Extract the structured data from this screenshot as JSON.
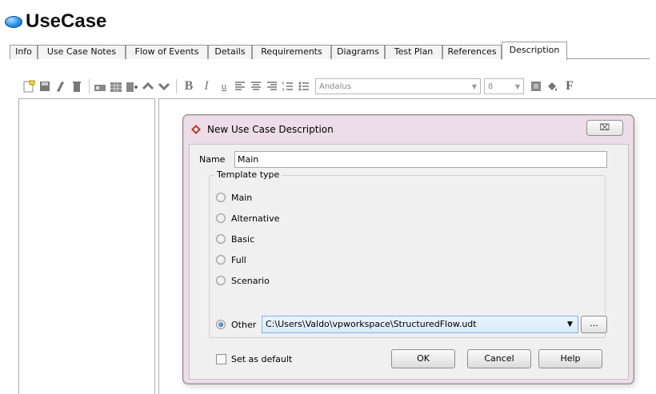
{
  "page": {
    "title": "UseCase"
  },
  "tabs": [
    {
      "label": "Info"
    },
    {
      "label": "Use Case Notes"
    },
    {
      "label": "Flow of Events"
    },
    {
      "label": "Details"
    },
    {
      "label": "Requirements"
    },
    {
      "label": "Diagrams"
    },
    {
      "label": "Test Plan"
    },
    {
      "label": "References"
    },
    {
      "label": "Description",
      "active": true
    }
  ],
  "toolbar": {
    "icons": [
      "new-page-icon",
      "save-icon",
      "format-icon",
      "delete-icon",
      "merge-cells-icon",
      "table-icon",
      "insert-row-icon",
      "move-up-icon",
      "move-down-icon"
    ],
    "bold": "B",
    "italic": "I",
    "underline": "u",
    "font_name": "Andalus",
    "font_size": "8",
    "trailing_text": "F"
  },
  "dialog": {
    "title": "New Use Case Description",
    "close_label": "⌧",
    "name_label": "Name",
    "name_value": "Main",
    "group_label": "Template type",
    "options": [
      {
        "label": "Main",
        "checked": false
      },
      {
        "label": "Alternative",
        "checked": false
      },
      {
        "label": "Basic",
        "checked": false
      },
      {
        "label": "Full",
        "checked": false
      },
      {
        "label": "Scenario",
        "checked": false
      },
      {
        "label": "Other",
        "checked": true
      }
    ],
    "other_path": "C:\\Users\\Valdo\\vpworkspace\\StructuredFlow.udt",
    "browse_label": "...",
    "set_default_label": "Set as default",
    "set_default_checked": false,
    "ok_label": "OK",
    "cancel_label": "Cancel",
    "help_label": "Help"
  },
  "colors": {
    "dialog_frame": "#eddde8",
    "selection": "#d8ebfb",
    "title_icon": "#2a8fe0",
    "dialog_icon": "#c0392b"
  }
}
